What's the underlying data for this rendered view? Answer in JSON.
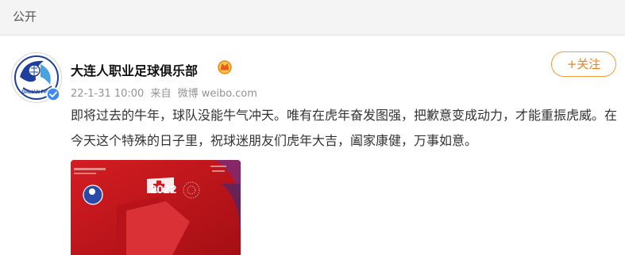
{
  "topbar": {
    "label": "公开"
  },
  "author": {
    "name": "大连人职业足球俱乐部",
    "avatar_text": "DALIAN PRO"
  },
  "meta": {
    "date": "22-1-31 10:00",
    "source_prefix": "来自",
    "source_name": "微博 weibo.com"
  },
  "follow_button": {
    "label": "+关注"
  },
  "post": {
    "text": "即将过去的牛年，球队没能牛气冲天。唯有在虎年奋发图强，把歉意变成动力，才能重振虎威。在今天这个特殊的日子里，祝球迷朋友们虎年大吉，阖家康健，万事如意。"
  },
  "image": {
    "year_text": "2022"
  },
  "colors": {
    "accent_orange": "#f07f1f",
    "club_blue": "#1e3f9a",
    "image_red": "#c8161d",
    "verified_blue": "#3d8bf2"
  }
}
